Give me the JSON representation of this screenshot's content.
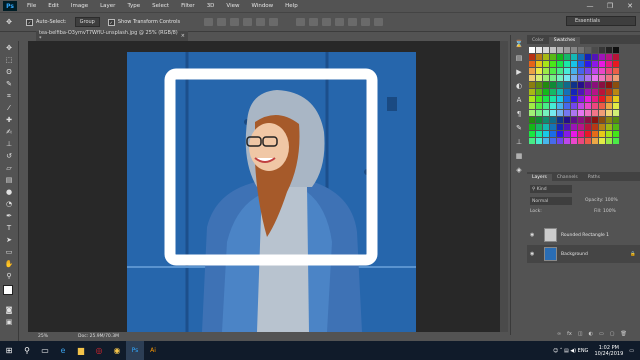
{
  "app": {
    "logo": "Ps"
  },
  "menubar": {
    "items": [
      "File",
      "Edit",
      "Image",
      "Layer",
      "Type",
      "Select",
      "Filter",
      "3D",
      "View",
      "Window",
      "Help"
    ]
  },
  "window_controls": {
    "minimize": "—",
    "maximize": "❐",
    "close": "✕"
  },
  "options": {
    "auto_select_label": "Auto-Select:",
    "auto_select_checked": true,
    "auto_select_value": "Group",
    "show_transform_label": "Show Transform Controls",
    "show_transform_checked": true
  },
  "workspace": {
    "label": "Essentials"
  },
  "document_tab": {
    "title": "tea-belfiba-O3ymvT7WfIU-unsplash.jpg @ 25% (RGB/8) *",
    "close": "×"
  },
  "status": {
    "zoom": "25%",
    "doc": "Doc: 25.9M/70.3M"
  },
  "panels": {
    "color_tab": "Color",
    "swatches_tab": "Swatches",
    "layers_tab": "Layers",
    "channels_tab": "Channels",
    "paths_tab": "Paths",
    "kind_label": "Kind",
    "blend_mode": "Normal",
    "opacity_label": "Opacity:",
    "opacity_value": "100%",
    "lock_label": "Lock:",
    "fill_label": "Fill:",
    "fill_value": "100%"
  },
  "layers": [
    {
      "name": "Rounded Rectangle 1",
      "visible": true,
      "selected": false
    },
    {
      "name": "Background",
      "visible": true,
      "selected": true
    }
  ],
  "tray": {
    "lang": "ENG",
    "time": "1:02 PM",
    "date": "10/24/2019"
  },
  "colors": {
    "accent": "#31a8ff",
    "photo_bg": "#2a6db4",
    "frame": "#ffffff"
  }
}
